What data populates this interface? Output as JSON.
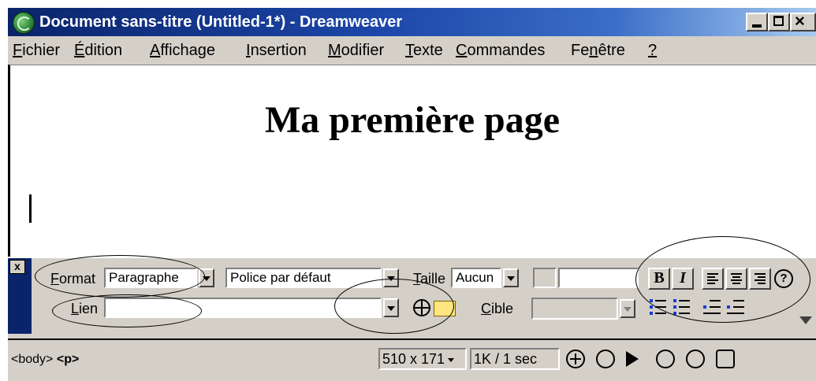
{
  "window": {
    "title": "Document sans-titre (Untitled-1*) - Dreamweaver",
    "controls": {
      "minimize": "minimize-icon",
      "maximize": "maximize-icon",
      "close": "close-icon",
      "close_glyph": "×"
    }
  },
  "menubar": {
    "items": [
      {
        "key": "F",
        "rest": "ichier"
      },
      {
        "key": "É",
        "rest": "dition"
      },
      {
        "key": "A",
        "rest": "ffichage"
      },
      {
        "key": "I",
        "rest": "nsertion"
      },
      {
        "key": "M",
        "rest": "odifier"
      },
      {
        "key": "T",
        "rest": "exte"
      },
      {
        "key": "C",
        "rest": "ommandes"
      },
      {
        "pre": "Fe",
        "key": "n",
        "rest": "être"
      },
      {
        "key": "?",
        "rest": ""
      }
    ]
  },
  "document": {
    "heading": "Ma première page"
  },
  "inspector": {
    "close_glyph": "x",
    "format": {
      "label_key": "F",
      "label_rest": "ormat",
      "value": "Paragraphe"
    },
    "font": {
      "value": "Police par défaut"
    },
    "size": {
      "label_key": "T",
      "label_rest": "aille",
      "value": "Aucun"
    },
    "link": {
      "label_key": "L",
      "label_rest": "ien",
      "value": ""
    },
    "target": {
      "label_key": "C",
      "label_rest": "ible",
      "value": ""
    },
    "buttons": {
      "bold": "B",
      "italic": "I",
      "help": "?"
    },
    "colors": {
      "accent_stripe": "#0a246a",
      "list_bullet": "#1a3bd6"
    }
  },
  "statusbar": {
    "tag_body": "<body>",
    "tag_p": "<p>",
    "window_size": "510 x 171",
    "download_stats": "1K / 1 sec"
  }
}
